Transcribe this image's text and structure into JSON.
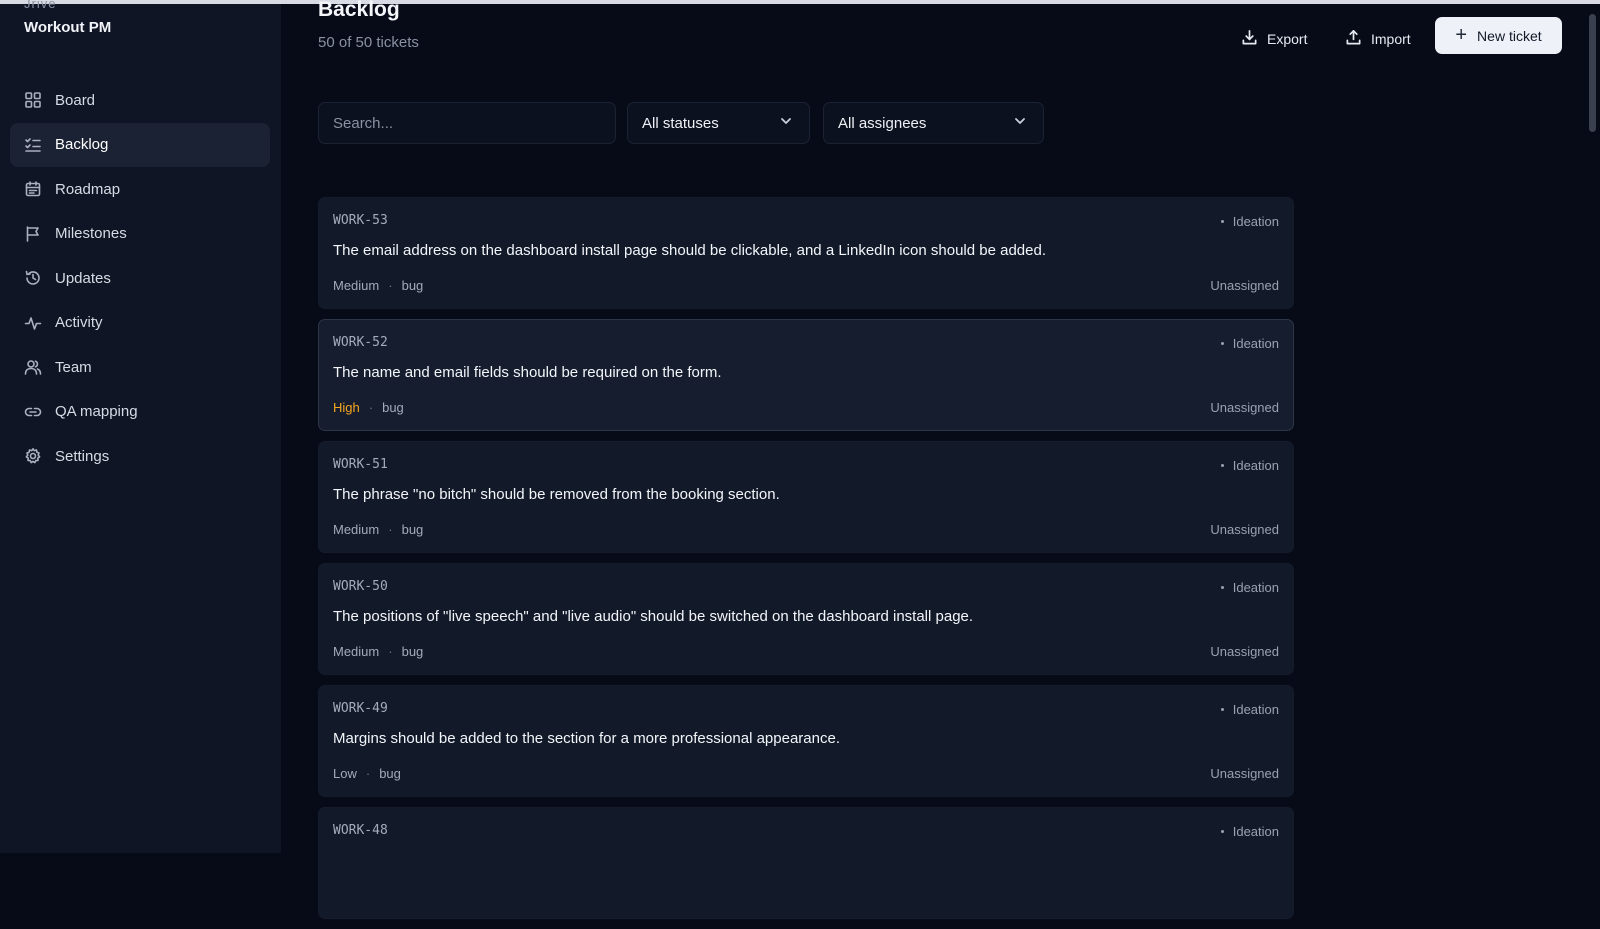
{
  "brand": {
    "top_text": "Jrive",
    "name": "Workout PM"
  },
  "nav": [
    {
      "label": "Board",
      "icon": "grid-icon"
    },
    {
      "label": "Backlog",
      "icon": "list-check-icon",
      "active": true
    },
    {
      "label": "Roadmap",
      "icon": "calendar-icon"
    },
    {
      "label": "Milestones",
      "icon": "flag-icon"
    },
    {
      "label": "Updates",
      "icon": "history-icon"
    },
    {
      "label": "Activity",
      "icon": "activity-icon"
    },
    {
      "label": "Team",
      "icon": "users-icon"
    },
    {
      "label": "QA mapping",
      "icon": "link-icon"
    },
    {
      "label": "Settings",
      "icon": "gear-icon"
    }
  ],
  "header": {
    "title": "Backlog",
    "subtitle": "50 of 50 tickets",
    "export_label": "Export",
    "import_label": "Import",
    "new_ticket_label": "New ticket"
  },
  "filters": {
    "search_placeholder": "Search...",
    "status_value": "All statuses",
    "assignee_value": "All assignees"
  },
  "tickets": [
    {
      "id": "WORK-53",
      "status": "Ideation",
      "title": "The email address on the dashboard install page should be clickable, and a LinkedIn icon should be added.",
      "priority": "Medium",
      "label": "bug",
      "assignee": "Unassigned"
    },
    {
      "id": "WORK-52",
      "status": "Ideation",
      "title": "The name and email fields should be required on the form.",
      "priority": "High",
      "label": "bug",
      "assignee": "Unassigned"
    },
    {
      "id": "WORK-51",
      "status": "Ideation",
      "title": "The phrase \"no bitch\" should be removed from the booking section.",
      "priority": "Medium",
      "label": "bug",
      "assignee": "Unassigned"
    },
    {
      "id": "WORK-50",
      "status": "Ideation",
      "title": "The positions of \"live speech\" and \"live audio\" should be switched on the dashboard install page.",
      "priority": "Medium",
      "label": "bug",
      "assignee": "Unassigned"
    },
    {
      "id": "WORK-49",
      "status": "Ideation",
      "title": "Margins should be added to the section for a more professional appearance.",
      "priority": "Low",
      "label": "bug",
      "assignee": "Unassigned"
    },
    {
      "id": "WORK-48",
      "status": "Ideation",
      "title": "",
      "priority": "",
      "label": "",
      "assignee": ""
    }
  ],
  "colors": {
    "accent_high": "#f5a623",
    "background": "#070b17",
    "sidebar": "#0f1524",
    "card": "#121a2a"
  }
}
